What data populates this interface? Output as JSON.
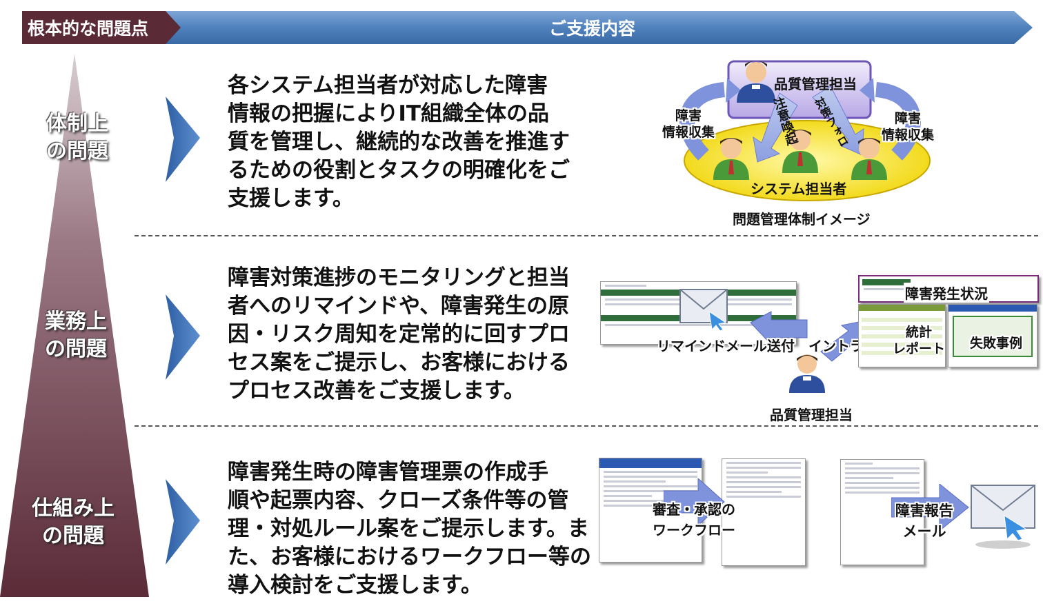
{
  "header": {
    "left_label": "根本的な問題点",
    "right_label": "ご支援内容",
    "colors": {
      "left_bg": "#5a2a36",
      "right_bg": "#4f81bd"
    }
  },
  "issues": [
    {
      "label": "体制上\nの問題"
    },
    {
      "label": "業務上\nの問題"
    },
    {
      "label": "仕組み上\nの問題"
    }
  ],
  "descriptions": [
    {
      "text": "各システム担当者が対応した障害\n情報の把握によりIT組織全体の品\n質を管理し、継続的な改善を推進す\nるための役割とタスクの明確化をご\n支援します。"
    },
    {
      "text": "障害対策進捗のモニタリングと担当\n者へのリマインドや、障害発生の原\n因・リスク周知を定常的に回すプロ\nセス案をご提示し、お客様における\nプロセス改善をご支援します。"
    },
    {
      "text": "障害発生時の障害管理票の作成手\n順や起票内容、クローズ条件等の管\n理・対処ルール案をご提示します。ま\nた、お客様におけるワークフロー等の\n導入検討をご支援します。"
    }
  ],
  "diagram1": {
    "quality_manager": "品質管理担当",
    "left_collect": "障害\n情報収集",
    "right_collect": "障害\n情報収集",
    "alert": "注意喚起",
    "follow": "対策フォロ",
    "system_staff": "システム担当者",
    "caption": "問題管理体制イメージ"
  },
  "diagram2": {
    "reminder": "リマインドメール送付",
    "intranet": "イントラ掲載",
    "status": "障害発生状況",
    "stats": "統計\nレポート",
    "failure": "失敗事例",
    "manager": "品質管理担当"
  },
  "diagram3": {
    "workflow": "審査・承認の\nワークフロー",
    "report_mail": "障害報告\nメール"
  }
}
